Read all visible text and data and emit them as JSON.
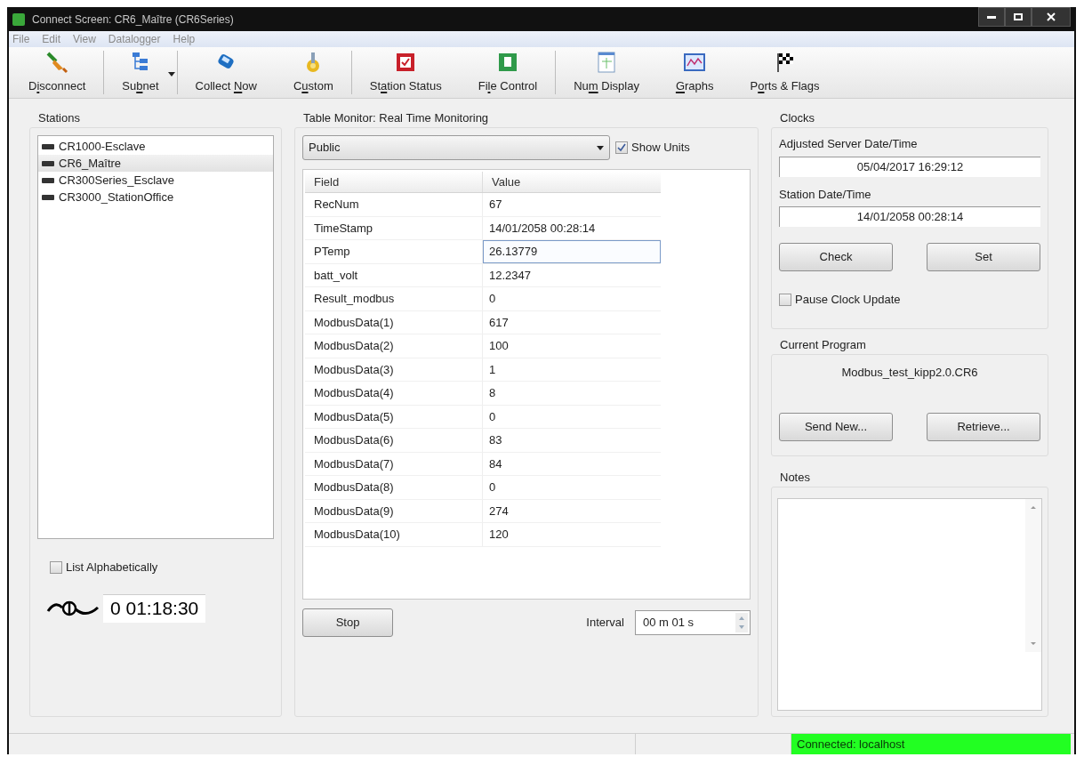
{
  "window": {
    "title": "Connect Screen: CR6_Maître (CR6Series)"
  },
  "menu": [
    "File",
    "Edit",
    "View",
    "Datalogger",
    "Help"
  ],
  "toolbar": [
    {
      "kind": "disconnect",
      "parts": [
        {
          "t": "D",
          "u": false
        },
        {
          "t": "i",
          "u": true
        },
        {
          "t": "sconnect",
          "u": false
        }
      ],
      "separator_after": true
    },
    {
      "kind": "subnet",
      "parts": [
        {
          "t": "Su",
          "u": false
        },
        {
          "t": "b",
          "u": true
        },
        {
          "t": "net",
          "u": false
        }
      ],
      "separator_after": true,
      "dropdown": true
    },
    {
      "kind": "collect",
      "parts": [
        {
          "t": "Collect ",
          "u": false
        },
        {
          "t": "N",
          "u": true
        },
        {
          "t": "ow",
          "u": false
        }
      ],
      "separator_after": false
    },
    {
      "kind": "custom",
      "parts": [
        {
          "t": "C",
          "u": false
        },
        {
          "t": "u",
          "u": true
        },
        {
          "t": "stom",
          "u": false
        }
      ],
      "separator_after": true
    },
    {
      "kind": "status",
      "parts": [
        {
          "t": "St",
          "u": false
        },
        {
          "t": "a",
          "u": true
        },
        {
          "t": "tion Status",
          "u": false
        }
      ],
      "separator_after": false
    },
    {
      "kind": "file",
      "parts": [
        {
          "t": "Fi",
          "u": false
        },
        {
          "t": "l",
          "u": true
        },
        {
          "t": "e Control",
          "u": false
        }
      ],
      "separator_after": true
    },
    {
      "kind": "num",
      "parts": [
        {
          "t": "Nu",
          "u": false
        },
        {
          "t": "m",
          "u": true
        },
        {
          "t": " Display",
          "u": false
        }
      ],
      "separator_after": false
    },
    {
      "kind": "graphs",
      "parts": [
        {
          "t": "G",
          "u": true
        },
        {
          "t": "raphs",
          "u": false
        }
      ],
      "separator_after": false
    },
    {
      "kind": "ports",
      "parts": [
        {
          "t": "P",
          "u": false
        },
        {
          "t": "o",
          "u": true
        },
        {
          "t": "rts & Flags",
          "u": false
        }
      ],
      "separator_after": false
    }
  ],
  "stations": {
    "title": "Stations",
    "items": [
      {
        "name": "CR1000-Esclave",
        "selected": false
      },
      {
        "name": "CR6_Maître",
        "selected": true
      },
      {
        "name": "CR300Series_Esclave",
        "selected": false
      },
      {
        "name": "CR3000_StationOffice",
        "selected": false
      }
    ],
    "list_alphabetically": {
      "label": "List Alphabetically",
      "checked": false
    },
    "elapsed": "0 01:18:30"
  },
  "monitor": {
    "title": "Table Monitor: Real Time Monitoring",
    "table_select": "Public",
    "show_units": {
      "label": "Show Units",
      "checked": true
    },
    "columns": [
      "Field",
      "Value"
    ],
    "rows": [
      {
        "field": "RecNum",
        "value": "67",
        "selected": false
      },
      {
        "field": "TimeStamp",
        "value": "14/01/2058 00:28:14",
        "selected": false
      },
      {
        "field": "PTemp",
        "value": "26.13779",
        "selected": true
      },
      {
        "field": "batt_volt",
        "value": "12.2347",
        "selected": false
      },
      {
        "field": "Result_modbus",
        "value": "0",
        "selected": false
      },
      {
        "field": "ModbusData(1)",
        "value": "617",
        "selected": false
      },
      {
        "field": "ModbusData(2)",
        "value": "100",
        "selected": false
      },
      {
        "field": "ModbusData(3)",
        "value": "1",
        "selected": false
      },
      {
        "field": "ModbusData(4)",
        "value": "8",
        "selected": false
      },
      {
        "field": "ModbusData(5)",
        "value": "0",
        "selected": false
      },
      {
        "field": "ModbusData(6)",
        "value": "83",
        "selected": false
      },
      {
        "field": "ModbusData(7)",
        "value": "84",
        "selected": false
      },
      {
        "field": "ModbusData(8)",
        "value": "0",
        "selected": false
      },
      {
        "field": "ModbusData(9)",
        "value": "274",
        "selected": false
      },
      {
        "field": "ModbusData(10)",
        "value": "120",
        "selected": false
      }
    ],
    "stop_button": "Stop",
    "interval_label": "Interval",
    "interval": "00 m 01 s"
  },
  "clocks": {
    "title": "Clocks",
    "server_label": "Adjusted Server Date/Time",
    "server_time": "05/04/2017 16:29:12",
    "station_label": "Station Date/Time",
    "station_time": "14/01/2058 00:28:14",
    "buttons": [
      "Check",
      "Set"
    ],
    "pause": {
      "label": "Pause Clock Update",
      "checked": false
    }
  },
  "program": {
    "title": "Current Program",
    "name": "Modbus_test_kipp2.0.CR6",
    "buttons": [
      "Send New...",
      "Retrieve..."
    ]
  },
  "notes": {
    "title": "Notes"
  },
  "status_bar": {
    "connection": "Connected: localhost",
    "connected": true
  }
}
